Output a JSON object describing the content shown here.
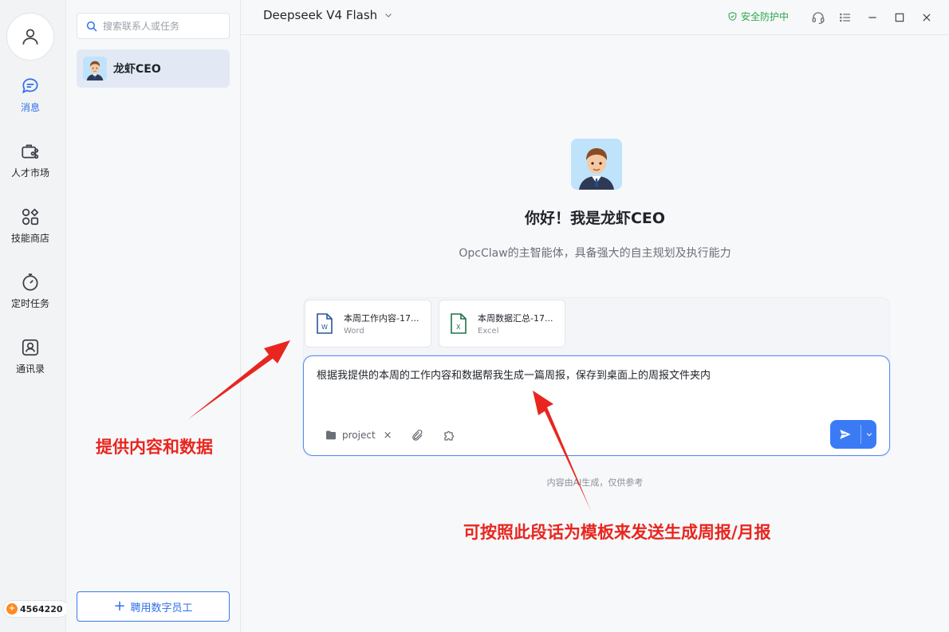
{
  "sidebar": {
    "items": [
      {
        "label": "消息",
        "icon": "chat-bubble-icon",
        "active": true
      },
      {
        "label": "人才市场",
        "icon": "briefcase-share-icon",
        "active": false
      },
      {
        "label": "技能商店",
        "icon": "apps-grid-icon",
        "active": false
      },
      {
        "label": "定时任务",
        "icon": "stopwatch-icon",
        "active": false
      },
      {
        "label": "通讯录",
        "icon": "contact-card-icon",
        "active": false
      }
    ],
    "points": "4564220"
  },
  "contacts": {
    "search_placeholder": "搜索联系人或任务",
    "items": [
      {
        "name": "龙虾CEO",
        "selected": true
      }
    ],
    "hire_button": "聘用数字员工"
  },
  "topbar": {
    "model": "Deepseek V4 Flash",
    "security": "安全防护中"
  },
  "hero": {
    "title": "你好！我是龙虾CEO",
    "subtitle": "OpcClaw的主智能体，具备强大的自主规划及执行能力"
  },
  "attachments": [
    {
      "name": "本周工作内容-17...",
      "type": "Word"
    },
    {
      "name": "本周数据汇总-17...",
      "type": "Excel"
    }
  ],
  "composer": {
    "message": "根据我提供的本周的工作内容和数据帮我生成一篇周报，保存到桌面上的周报文件夹内",
    "folder": "project"
  },
  "disclaimer": "内容由AI生成，仅供参考",
  "annotations": {
    "left": "提供内容和数据",
    "right": "可按照此段话为模板来发送生成周报/月报"
  },
  "colors": {
    "accent": "#2f6fea",
    "annotation": "#e8261f",
    "security": "#2ca64c",
    "word": "#2b579a",
    "excel": "#217346"
  }
}
